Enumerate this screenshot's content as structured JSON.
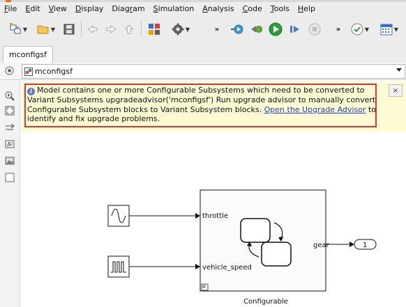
{
  "menubar": {
    "items": [
      {
        "label": "File",
        "key": "F"
      },
      {
        "label": "Edit",
        "key": "E"
      },
      {
        "label": "View",
        "key": "V"
      },
      {
        "label": "Display",
        "key": "D"
      },
      {
        "label": "Diagram",
        "key": "r"
      },
      {
        "label": "Simulation",
        "key": "S"
      },
      {
        "label": "Analysis",
        "key": "A"
      },
      {
        "label": "Code",
        "key": "C"
      },
      {
        "label": "Tools",
        "key": "T"
      },
      {
        "label": "Help",
        "key": "H"
      }
    ]
  },
  "tab": {
    "label": "mconfigsf"
  },
  "breadcrumb": {
    "label": "mconfigsf"
  },
  "banner": {
    "text_before_link": "Model contains one or more Configurable Subsystems which need to be converted to Variant Subsystems upgradeadvisor('mconfigsf') Run upgrade advisor to manually convert Configurable Subsystem blocks to Variant Subsystem blocks.",
    "link": "Open the Upgrade Advisor",
    "text_after_link": "to identify and fix upgrade problems.",
    "close": "×"
  },
  "diagram": {
    "subsystem_name": "Configurable",
    "port_in_1": "throttle",
    "port_in_2": "vehicle_speed",
    "port_out": "gear",
    "outport_value": "1"
  },
  "colors": {
    "banner_bg": "#fdfbd4",
    "banner_border": "#e0343a",
    "link": "#1a3fc2",
    "run_green": "#2e9c3a"
  }
}
